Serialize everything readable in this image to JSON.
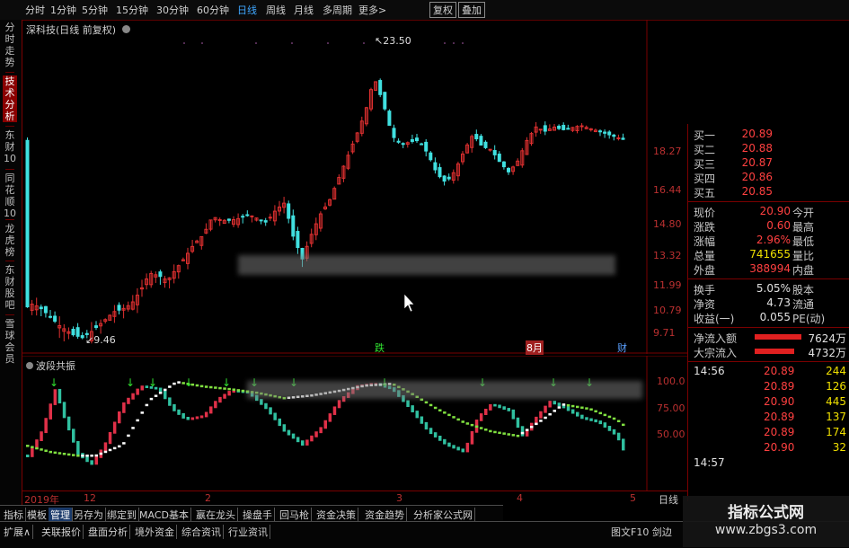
{
  "toolbar": {
    "items": [
      "分时",
      "1分钟",
      "5分钟",
      "15分钟",
      "30分钟",
      "60分钟",
      "日线",
      "周线",
      "月线",
      "多周期",
      "更多>"
    ],
    "active": "日线",
    "right_items": [
      "复权",
      "叠加"
    ]
  },
  "left_tabs": [
    "分时走势",
    "技术分析",
    "东财10",
    "同花顺10",
    "龙虎榜",
    "东财股吧",
    "雪球会员"
  ],
  "main_chart": {
    "title": "深科技(日线 前复权)",
    "high_label": "23.50",
    "low_label": "9.46",
    "y_ticks": [
      "18.27",
      "16.44",
      "14.80",
      "13.32",
      "11.99",
      "10.79",
      "9.71"
    ],
    "markers": [
      "跌",
      "8月",
      "财"
    ]
  },
  "indicator": {
    "title": "波段共振",
    "y_ticks": [
      "100.0",
      "75.00",
      "50.00"
    ]
  },
  "x_axis": [
    "2019年",
    "12",
    "2",
    "3",
    "4",
    "5"
  ],
  "x_axis_end": "日线",
  "quote": {
    "bids": [
      {
        "label": "买一",
        "price": "20.89"
      },
      {
        "label": "买二",
        "price": "20.88"
      },
      {
        "label": "买三",
        "price": "20.87"
      },
      {
        "label": "买四",
        "price": "20.86"
      },
      {
        "label": "买五",
        "price": "20.85"
      }
    ],
    "stats": [
      {
        "label": "现价",
        "value": "20.90",
        "label2": "今开"
      },
      {
        "label": "涨跌",
        "value": "0.60",
        "label2": "最高"
      },
      {
        "label": "涨幅",
        "value": "2.96%",
        "label2": "最低"
      },
      {
        "label": "总量",
        "value": "741655",
        "label2": "量比"
      },
      {
        "label": "外盘",
        "value": "388994",
        "label2": "内盘"
      }
    ],
    "stats2": [
      {
        "label": "换手",
        "value": "5.05%",
        "label2": "股本"
      },
      {
        "label": "净资",
        "value": "4.73",
        "label2": "流通"
      },
      {
        "label": "收益(一)",
        "value": "0.055",
        "label2": "PE(动)"
      }
    ],
    "flows": [
      {
        "label": "净流入额",
        "value": "7624万"
      },
      {
        "label": "大宗流入",
        "value": "4732万"
      }
    ],
    "ticks": [
      {
        "time": "14:56",
        "price": "20.89",
        "vol": "244"
      },
      {
        "time": "",
        "price": "20.89",
        "vol": "126"
      },
      {
        "time": "",
        "price": "20.90",
        "vol": "445"
      },
      {
        "time": "",
        "price": "20.89",
        "vol": "137"
      },
      {
        "time": "",
        "price": "20.89",
        "vol": "174"
      },
      {
        "time": "",
        "price": "20.90",
        "vol": "32"
      },
      {
        "time": "14:57",
        "price": "",
        "vol": ""
      }
    ]
  },
  "bottom_tabs_1": [
    "指标",
    "模板",
    "管理",
    "另存为",
    "绑定到",
    "MACD基本",
    "嬴在龙头",
    "操盘手",
    "回马枪",
    "资金决策",
    "资金趋势",
    "分析家公式网"
  ],
  "bottom_tabs_1_active": "管理",
  "bottom_tabs_2": [
    "扩展∧",
    "关联报价",
    "盘面分析",
    "境外资金",
    "综合资讯",
    "行业资讯"
  ],
  "bottom_right": "图文F10  剑边",
  "watermark": {
    "line1": "指标公式网",
    "line2": "www.zbgs3.com"
  },
  "colors": {
    "up": "#e03030",
    "down": "#40e0e0",
    "accent_red": "#8a0000",
    "watermark_bg": "#151515"
  }
}
